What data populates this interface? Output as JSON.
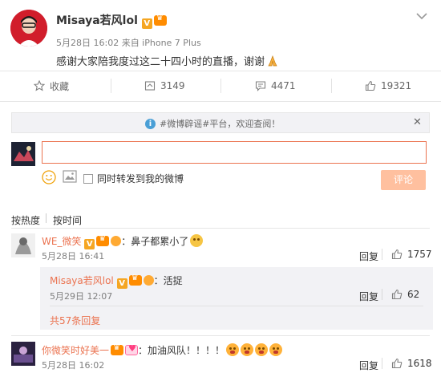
{
  "post": {
    "author": "Misaya若风lol",
    "meta": "5月28日 16:02 来自 iPhone 7 Plus",
    "text": "感谢大家陪我度过这二十四小时的直播，谢谢"
  },
  "actions": {
    "favorite": "收藏",
    "repost_count": "3149",
    "comment_count": "4471",
    "like_count": "19321"
  },
  "notice": {
    "text": "#微博辟谣#平台，欢迎查阅！"
  },
  "composer": {
    "placeholder": "",
    "repost_label": "同时转发到我的微博",
    "submit_label": "评论"
  },
  "sort": {
    "by_hot": "按热度",
    "by_time": "按时间"
  },
  "comments": [
    {
      "user": "WE_微笑",
      "text": "：鼻子都累小了",
      "time": "5月28日 16:41",
      "reply_label": "回复",
      "like_count": "1757",
      "sub_replies": [
        {
          "user": "Misaya若风lol",
          "text": "：活捉",
          "time": "5月29日 12:07",
          "reply_label": "回复",
          "like_count": "62"
        }
      ],
      "more_replies": "共57条回复"
    },
    {
      "user": "你微笑时好美一",
      "text": "：加油风队！！！！",
      "time": "5月28日 16:02",
      "reply_label": "回复",
      "like_count": "1618"
    }
  ],
  "colors": {
    "accent": "#eb7350",
    "verified": "#f5a623",
    "muted": "#808080"
  }
}
